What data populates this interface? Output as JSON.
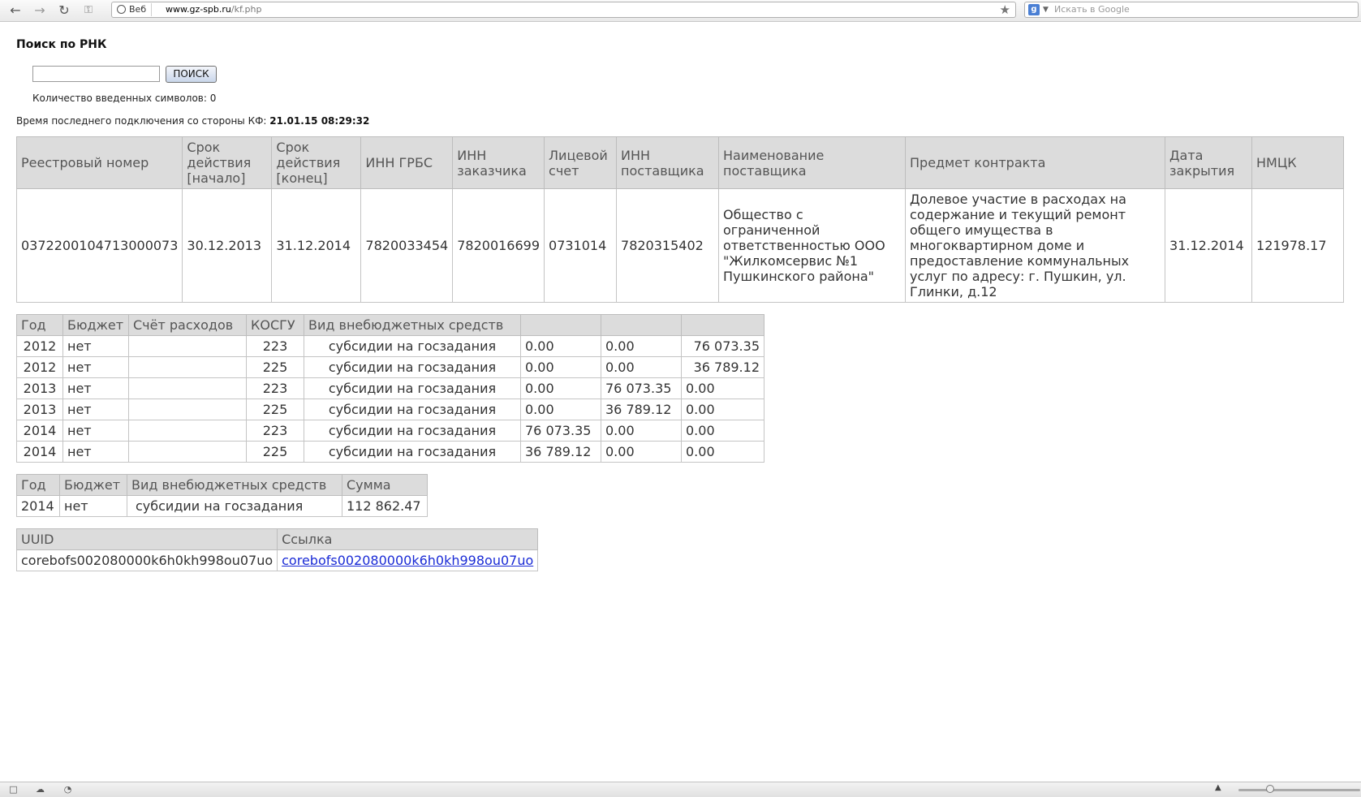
{
  "browser": {
    "web_chip": "Веб",
    "url_host": "www.gz-spb.ru",
    "url_path": "/kf.php",
    "search_placeholder": "Искать в Google"
  },
  "page": {
    "title": "Поиск по РНК",
    "search_input_value": "",
    "search_button": "ПОИСК",
    "counter_label": "Количество введенных символов: 0",
    "last_connection_label": "Время последнего подключения со стороны КФ:",
    "last_connection_value": "21.01.15 08:29:32"
  },
  "main_table": {
    "headers": [
      "Реестровый номер",
      "Срок действия [начало]",
      "Срок действия [конец]",
      "ИНН ГРБС",
      "ИНН заказчика",
      "Лицевой счет",
      "ИНН поставщика",
      "Наименование поставщика",
      "Предмет контракта",
      "Дата закрытия",
      "НМЦК"
    ],
    "row": [
      "0372200104713000073",
      "30.12.2013",
      "31.12.2014",
      "7820033454",
      "7820016699",
      "0731014",
      "7820315402",
      "Общество с ограниченной ответственностью ООО \"Жилкомсервис №1 Пушкинского района\"",
      "Долевое участие в расходах на содержание и текущий ремонт общего имущества в многоквартирном доме и предоставление коммунальных услуг по адресу: г. Пушкин, ул. Глинки, д.12",
      "31.12.2014",
      "121978.17"
    ]
  },
  "fin_table": {
    "headers": [
      "Год",
      "Бюджет",
      "Счёт расходов",
      "КОСГУ",
      "Вид внебюджетных средств",
      "",
      "",
      ""
    ],
    "rows": [
      [
        "2012",
        "нет",
        "",
        "223",
        "субсидии на госзадания",
        "0.00",
        "0.00",
        "76 073.35"
      ],
      [
        "2012",
        "нет",
        "",
        "225",
        "субсидии на госзадания",
        "0.00",
        "0.00",
        "36 789.12"
      ],
      [
        "2013",
        "нет",
        "",
        "223",
        "субсидии на госзадания",
        "0.00",
        "76 073.35",
        "0.00"
      ],
      [
        "2013",
        "нет",
        "",
        "225",
        "субсидии на госзадания",
        "0.00",
        "36 789.12",
        "0.00"
      ],
      [
        "2014",
        "нет",
        "",
        "223",
        "субсидии на госзадания",
        "76 073.35",
        "0.00",
        "0.00"
      ],
      [
        "2014",
        "нет",
        "",
        "225",
        "субсидии на госзадания",
        "36 789.12",
        "0.00",
        "0.00"
      ]
    ]
  },
  "sum_table": {
    "headers": [
      "Год",
      "Бюджет",
      "Вид внебюджетных средств",
      "Сумма"
    ],
    "rows": [
      [
        "2014",
        "нет",
        "субсидии на госзадания",
        "112 862.47"
      ]
    ]
  },
  "uuid_table": {
    "headers": [
      "UUID",
      "Ссылка"
    ],
    "uuid": "corebofs002080000k6h0kh998ou07uo",
    "link": "corebofs002080000k6h0kh998ou07uo"
  }
}
